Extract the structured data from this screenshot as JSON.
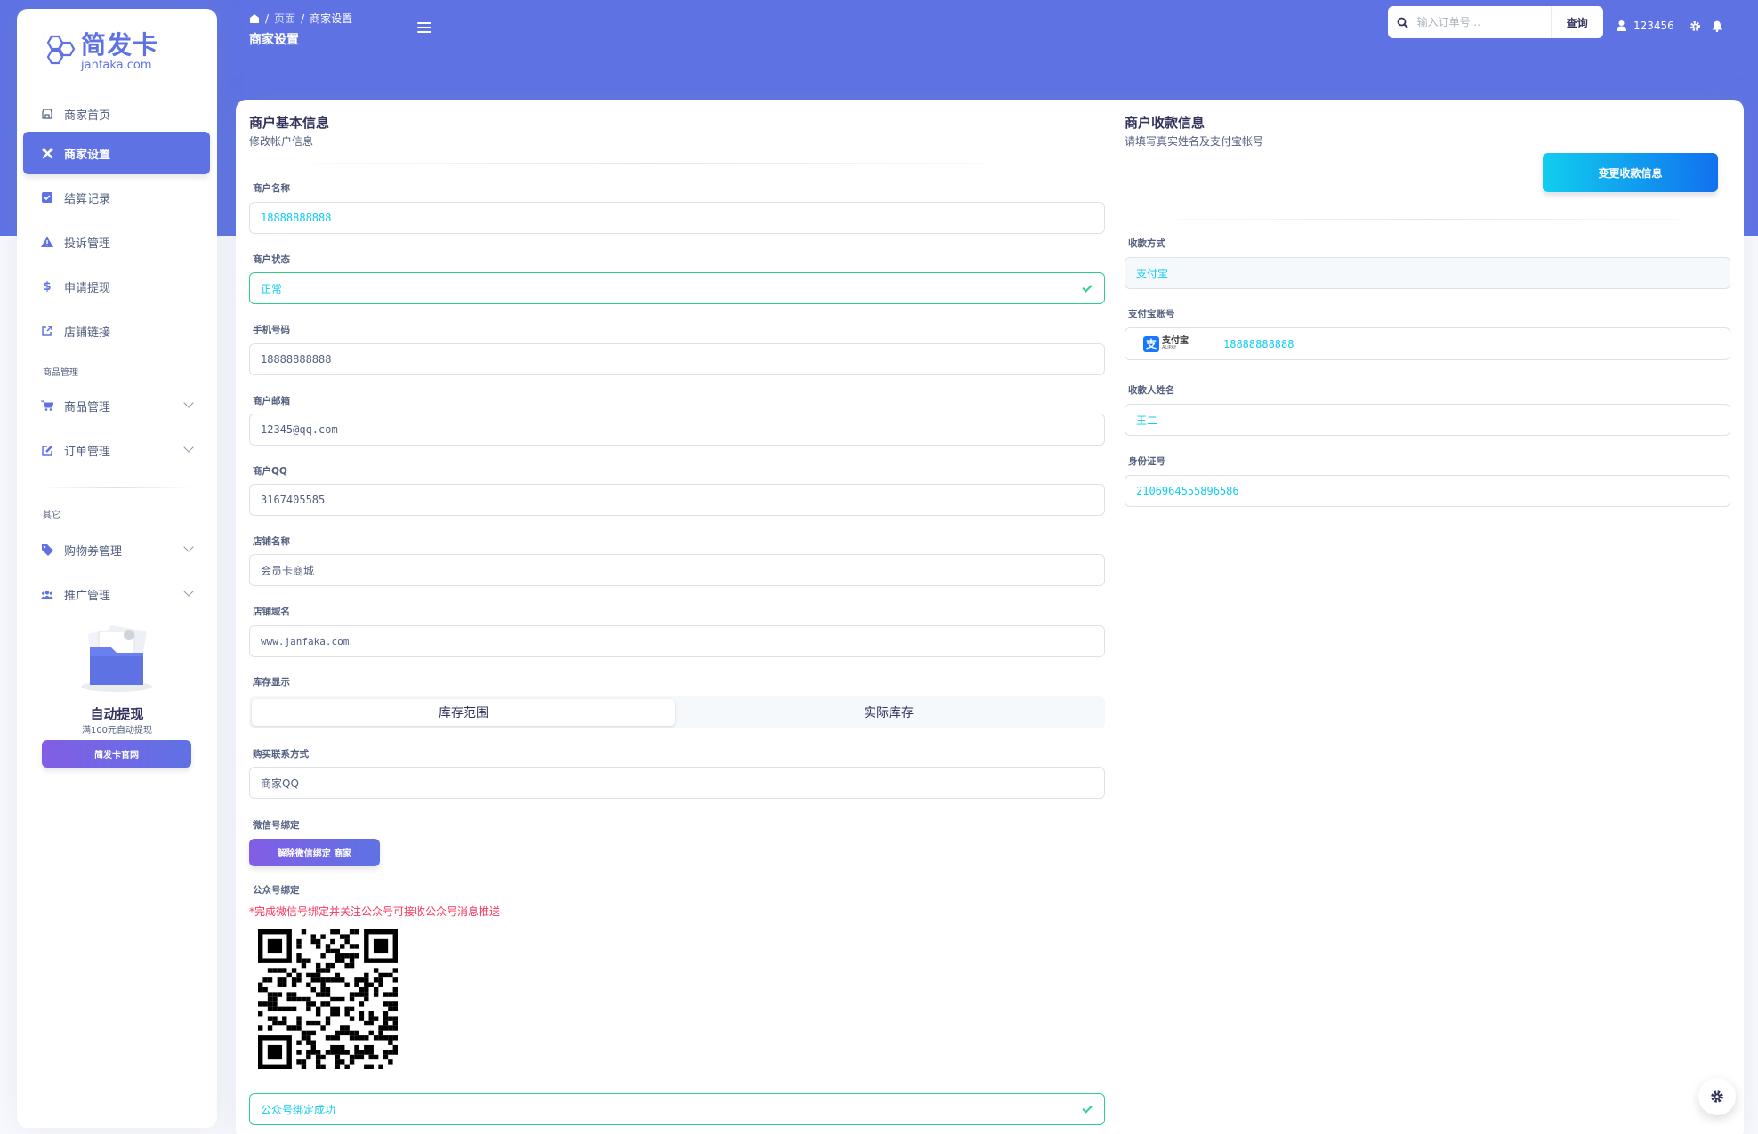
{
  "colors": {
    "primary": "#5e72e4",
    "info": "#11cdef",
    "success": "#2dce89",
    "danger": "#f5365c"
  },
  "logo": {
    "main": "简发卡",
    "sub": "janfaka.com"
  },
  "sidebar": {
    "items": [
      {
        "label": "商家首页",
        "icon": "shop-icon"
      },
      {
        "label": "商家设置",
        "icon": "tools-icon"
      },
      {
        "label": "结算记录",
        "icon": "check-square-icon"
      },
      {
        "label": "投诉管理",
        "icon": "warning-icon"
      },
      {
        "label": "申请提现",
        "icon": "dollar-icon"
      },
      {
        "label": "店铺链接",
        "icon": "external-link-icon"
      }
    ],
    "section_goods": "商品管理",
    "goods_items": [
      {
        "label": "商品管理",
        "icon": "cart-icon"
      },
      {
        "label": "订单管理",
        "icon": "edit-icon"
      }
    ],
    "section_other": "其它",
    "other_items": [
      {
        "label": "购物券管理",
        "icon": "tag-icon"
      },
      {
        "label": "推广管理",
        "icon": "users-icon"
      }
    ],
    "promo": {
      "title": "自动提现",
      "subtitle": "满100元自动提现",
      "button": "简发卡官网"
    }
  },
  "header": {
    "breadcrumb": [
      "页面",
      "商家设置"
    ],
    "title": "商家设置",
    "search_placeholder": "输入订单号...",
    "search_button": "查询",
    "username": "123456"
  },
  "basic": {
    "title": "商户基本信息",
    "subtitle": "修改帐户信息",
    "fields": {
      "name_label": "商户名称",
      "name_value": "18888888888",
      "status_label": "商户状态",
      "status_value": "正常",
      "phone_label": "手机号码",
      "phone_value": "18888888888",
      "email_label": "商户邮箱",
      "email_value": "12345@qq.com",
      "qq_label": "商户QQ",
      "qq_value": "3167405585",
      "shop_label": "店铺名称",
      "shop_value": "会员卡商城",
      "domain_label": "店铺域名",
      "domain_value": "www.janfaka.com",
      "stock_label": "库存显示",
      "stock_options": [
        "库存范围",
        "实际库存"
      ],
      "contact_label": "购买联系方式",
      "contact_value": "商家QQ",
      "wechat_label": "微信号绑定",
      "wechat_button": "解除微信绑定 商家",
      "mp_label": "公众号绑定",
      "mp_notice": "*完成微信号绑定并关注公众号可接收公众号消息推送",
      "mp_status": "公众号绑定成功"
    }
  },
  "payment": {
    "title": "商户收款信息",
    "subtitle": "请填写真实姓名及支付宝帐号",
    "change_button": "变更收款信息",
    "method_label": "收款方式",
    "method_value": "支付宝",
    "account_label": "支付宝账号",
    "alipay_cn": "支付宝",
    "alipay_en": "ALIPAY",
    "account_value": "18888888888",
    "payee_label": "收款人姓名",
    "payee_value": "王二",
    "id_label": "身份证号",
    "id_value": "2106964555896586"
  }
}
